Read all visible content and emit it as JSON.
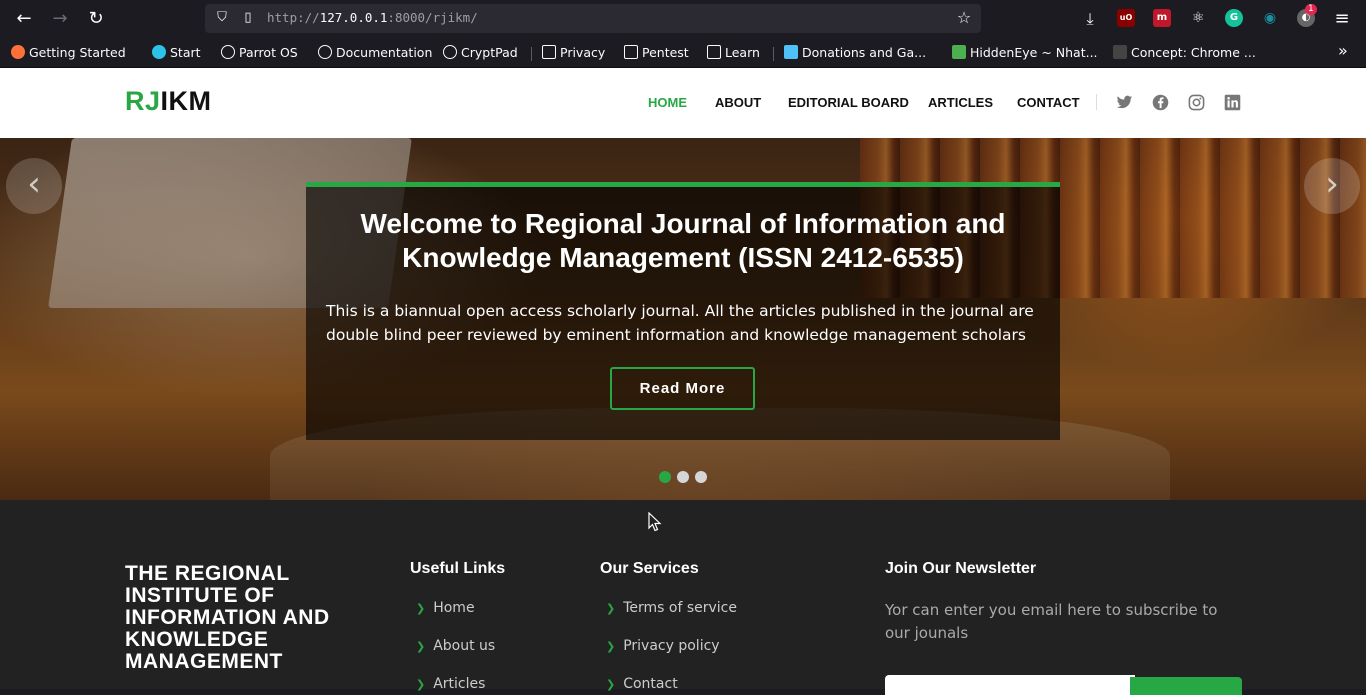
{
  "browser": {
    "url_prefix": "http://",
    "url_host": "127.0.0.1",
    "url_suffix": ":8000/rjikm/",
    "badge_count": "1",
    "bookmarks": [
      {
        "label": "Getting Started"
      },
      {
        "label": "Start"
      },
      {
        "label": "Parrot OS"
      },
      {
        "label": "Documentation"
      },
      {
        "label": "CryptPad"
      },
      {
        "label": "Privacy"
      },
      {
        "label": "Pentest"
      },
      {
        "label": "Learn"
      },
      {
        "label": "Donations and Ga..."
      },
      {
        "label": "HiddenEye ~ Nhat..."
      },
      {
        "label": "Concept: Chrome ..."
      }
    ]
  },
  "header": {
    "logo_accent": "RJ",
    "logo_rest": "IKM",
    "nav": [
      "HOME",
      "ABOUT",
      "EDITORIAL BOARD",
      "ARTICLES",
      "CONTACT"
    ]
  },
  "hero": {
    "title": "Welcome to Regional Journal of Information and Knowledge Management (ISSN 2412-6535)",
    "text": "This is a biannual open access scholarly journal. All the articles published in the journal are double blind peer reviewed by eminent information and knowledge management scholars",
    "button": "Read More"
  },
  "footer": {
    "org_name": "THE REGIONAL INSTITUTE OF INFORMATION AND KNOWLEDGE MANAGEMENT",
    "useful_links_heading": "Useful Links",
    "useful_links": [
      "Home",
      "About us",
      "Articles"
    ],
    "services_heading": "Our Services",
    "services": [
      "Terms of service",
      "Privacy policy",
      "Contact"
    ],
    "newsletter_heading": "Join Our Newsletter",
    "newsletter_text": "Yor can enter you email here to subscribe to our jounals"
  },
  "colors": {
    "accent": "#28a745",
    "footer_bg": "#222222",
    "browser_bg": "#1c1b22"
  }
}
